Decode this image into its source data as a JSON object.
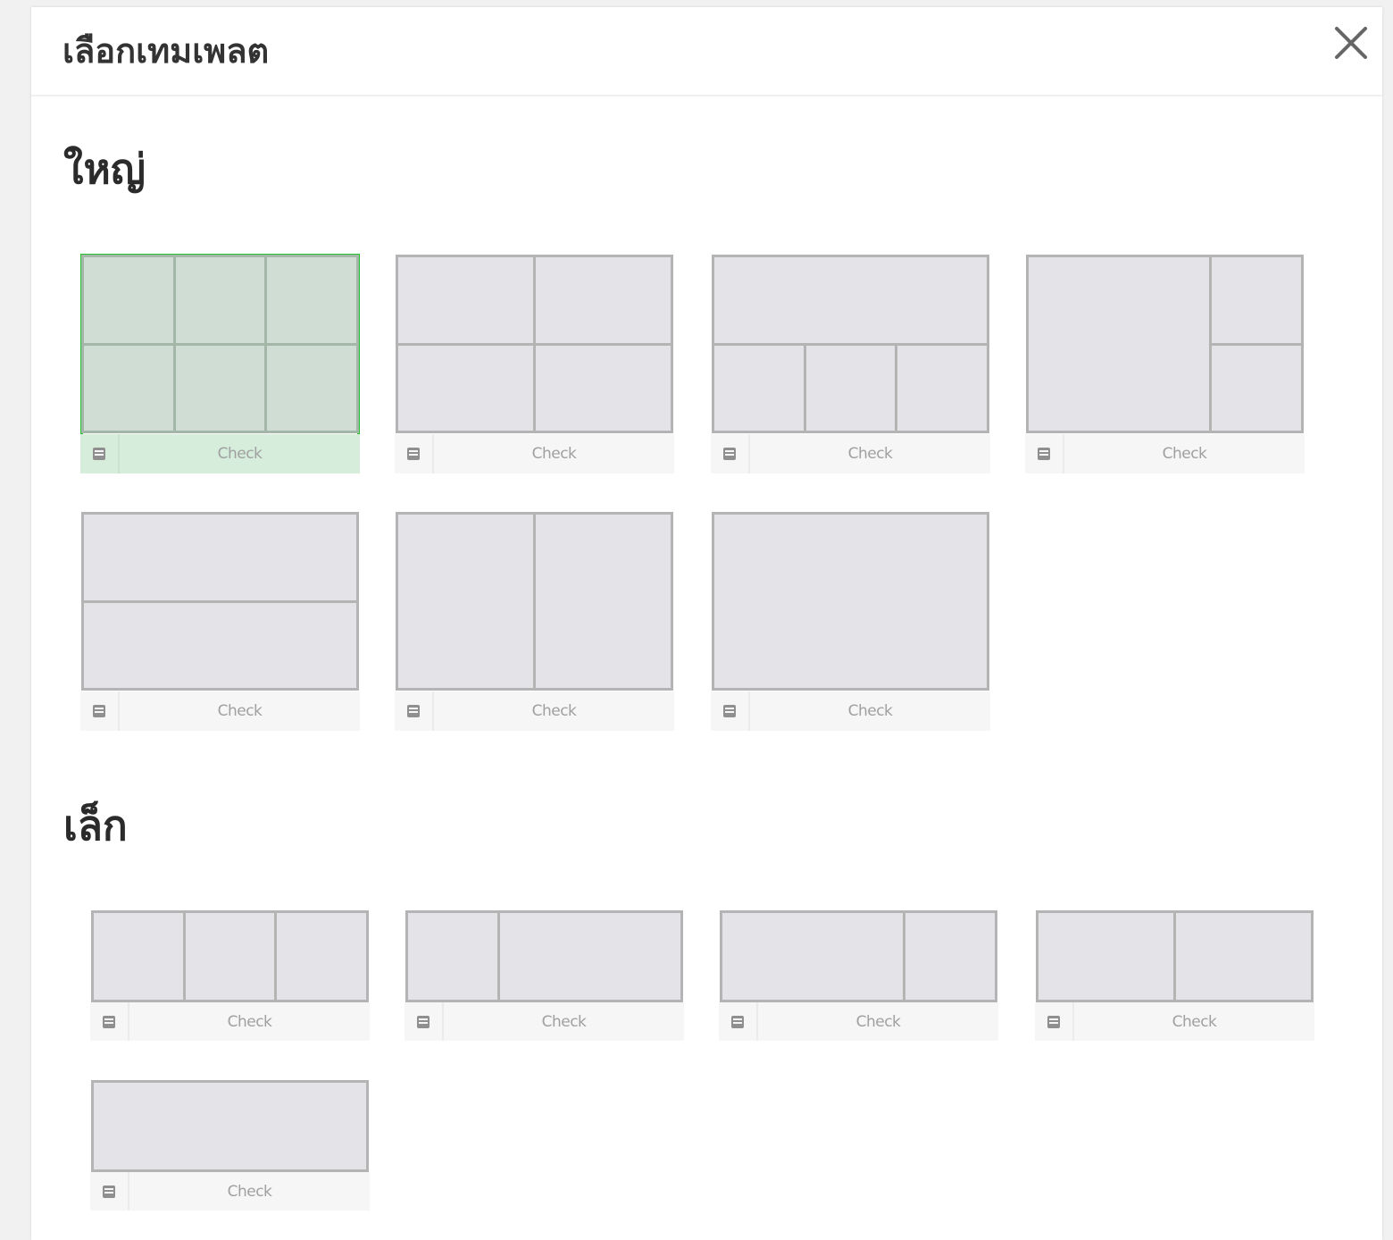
{
  "dialog": {
    "title": "เลือกเทมเพลต",
    "close_icon": "close-icon"
  },
  "sections": [
    {
      "title": "ใหญ่",
      "templates": [
        {
          "layout": "grid-3x2",
          "label": "Check",
          "selected": true
        },
        {
          "layout": "grid-2x2",
          "label": "Check",
          "selected": false
        },
        {
          "layout": "top-1-bottom-3",
          "label": "Check",
          "selected": false
        },
        {
          "layout": "left-1-right-2",
          "label": "Check",
          "selected": false
        },
        {
          "layout": "rows-2",
          "label": "Check",
          "selected": false
        },
        {
          "layout": "cols-2",
          "label": "Check",
          "selected": false
        },
        {
          "layout": "single",
          "label": "Check",
          "selected": false
        }
      ]
    },
    {
      "title": "เล็ก",
      "templates": [
        {
          "layout": "cols-3",
          "label": "Check",
          "selected": false
        },
        {
          "layout": "narrow-wide",
          "label": "Check",
          "selected": false
        },
        {
          "layout": "wide-narrow",
          "label": "Check",
          "selected": false
        },
        {
          "layout": "half-half",
          "label": "Check",
          "selected": false
        },
        {
          "layout": "single",
          "label": "Check",
          "selected": false
        }
      ]
    }
  ],
  "colors": {
    "selected_border": "#25c22f",
    "selected_fill": "#d0ddd4",
    "tile_fill": "#e4e3e8",
    "tile_line": "#b4b4b4"
  },
  "footer_icon": "template-icon"
}
